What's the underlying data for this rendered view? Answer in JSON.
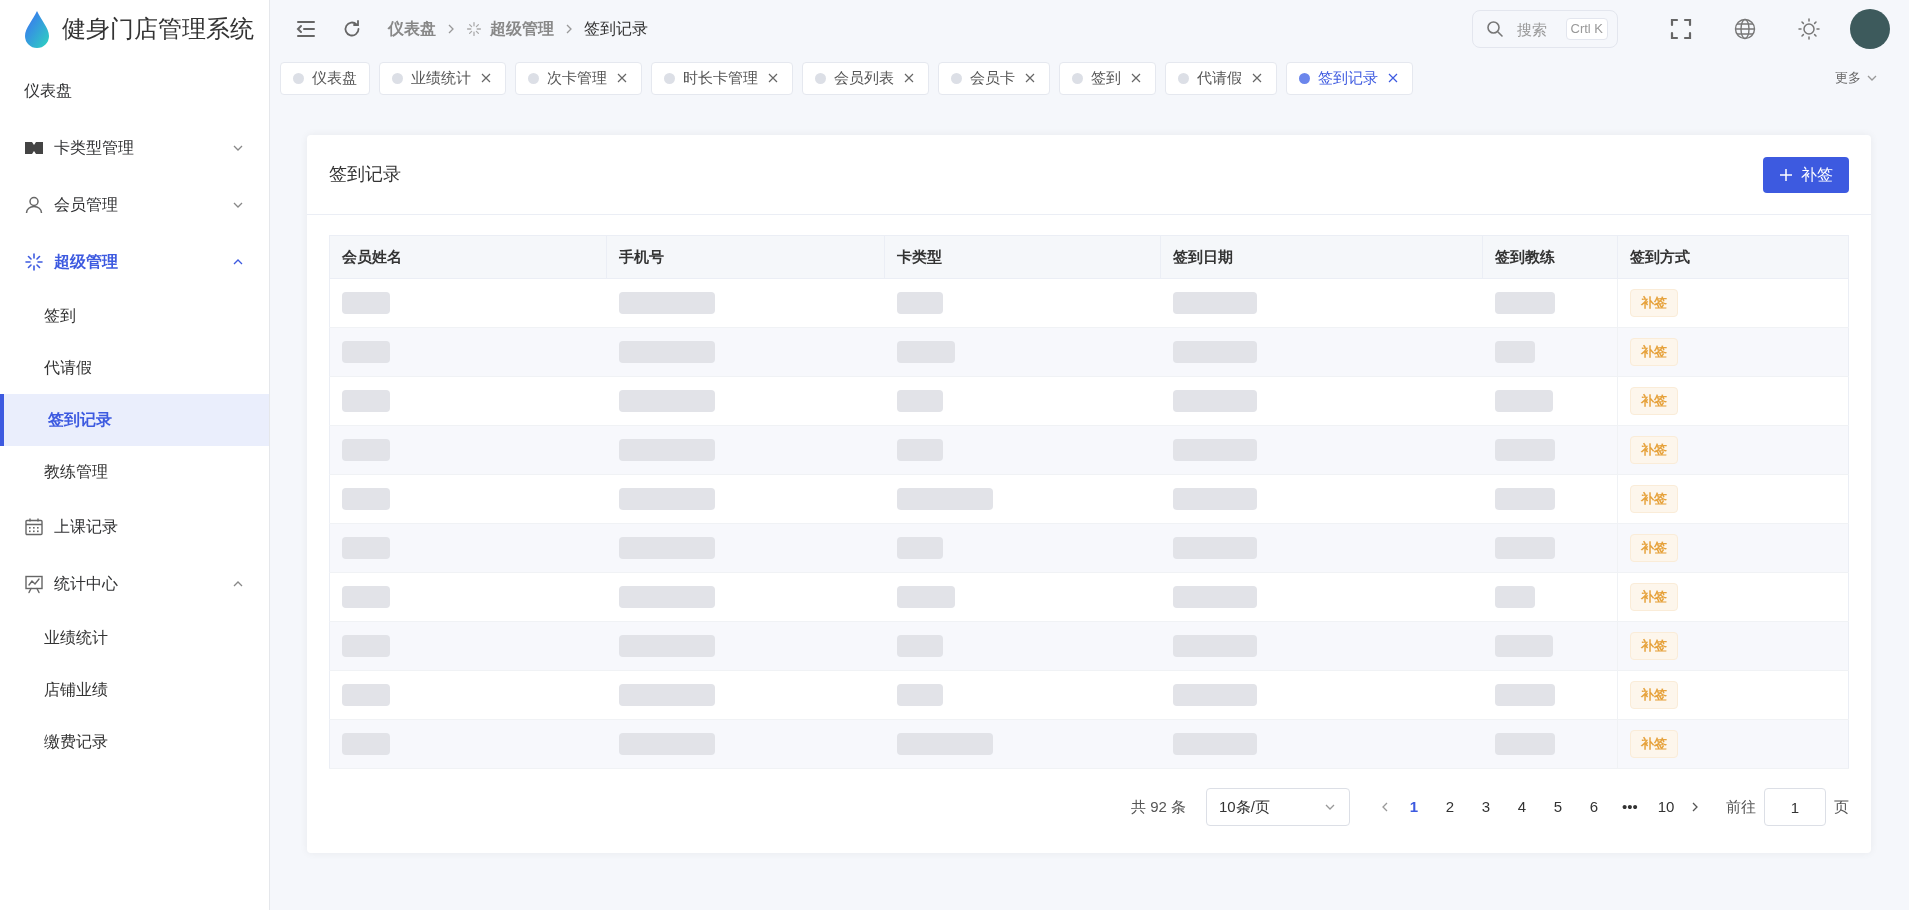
{
  "app": {
    "title": "健身门店管理系统"
  },
  "sidebar": {
    "items": [
      {
        "kind": "link",
        "label": "仪表盘",
        "selected": false
      },
      {
        "kind": "group",
        "label": "卡类型管理",
        "expanded": false,
        "active": false
      },
      {
        "kind": "group",
        "label": "会员管理",
        "expanded": false,
        "active": false
      },
      {
        "kind": "group",
        "label": "超级管理",
        "expanded": true,
        "active": true,
        "children": [
          {
            "label": "签到",
            "selected": false
          },
          {
            "label": "代请假",
            "selected": false
          },
          {
            "label": "签到记录",
            "selected": true
          },
          {
            "label": "教练管理",
            "selected": false
          }
        ]
      },
      {
        "kind": "link",
        "label": "上课记录",
        "selected": false
      },
      {
        "kind": "group",
        "label": "统计中心",
        "expanded": true,
        "active": false,
        "children": [
          {
            "label": "业绩统计",
            "selected": false
          },
          {
            "label": "店铺业绩",
            "selected": false
          },
          {
            "label": "缴费记录",
            "selected": false
          }
        ]
      }
    ]
  },
  "header": {
    "breadcrumb": [
      {
        "label": "仪表盘"
      },
      {
        "label": "超级管理"
      },
      {
        "label": "签到记录"
      }
    ],
    "search": {
      "placeholder": "搜索",
      "shortcut": "Crtl K"
    }
  },
  "tabs": {
    "items": [
      {
        "label": "仪表盘",
        "selected": false,
        "closable": false
      },
      {
        "label": "业绩统计",
        "selected": false,
        "closable": true
      },
      {
        "label": "次卡管理",
        "selected": false,
        "closable": true
      },
      {
        "label": "时长卡管理",
        "selected": false,
        "closable": true
      },
      {
        "label": "会员列表",
        "selected": false,
        "closable": true
      },
      {
        "label": "会员卡",
        "selected": false,
        "closable": true
      },
      {
        "label": "签到",
        "selected": false,
        "closable": true
      },
      {
        "label": "代请假",
        "selected": false,
        "closable": true
      },
      {
        "label": "签到记录",
        "selected": true,
        "closable": true
      }
    ],
    "more": "更多"
  },
  "card": {
    "title": "签到记录",
    "add_button": "补签"
  },
  "table": {
    "columns": [
      "会员姓名",
      "手机号",
      "卡类型",
      "签到日期",
      "签到教练",
      "签到方式"
    ],
    "rows": [
      {
        "sign_method": "补签"
      },
      {
        "sign_method": "补签"
      },
      {
        "sign_method": "补签"
      },
      {
        "sign_method": "补签"
      },
      {
        "sign_method": "补签"
      },
      {
        "sign_method": "补签"
      },
      {
        "sign_method": "补签"
      },
      {
        "sign_method": "补签"
      },
      {
        "sign_method": "补签"
      },
      {
        "sign_method": "补签"
      }
    ]
  },
  "pagination": {
    "total": "共 92 条",
    "page_size": "10条/页",
    "pages": [
      {
        "label": "1",
        "selected": true
      },
      {
        "label": "2",
        "selected": false
      },
      {
        "label": "3",
        "selected": false
      },
      {
        "label": "4",
        "selected": false
      },
      {
        "label": "5",
        "selected": false
      },
      {
        "label": "6",
        "selected": false
      },
      {
        "label": "•••",
        "selected": false
      },
      {
        "label": "10",
        "selected": false
      }
    ],
    "goto_label": "前往",
    "goto_value": "1",
    "page_unit": "页"
  }
}
